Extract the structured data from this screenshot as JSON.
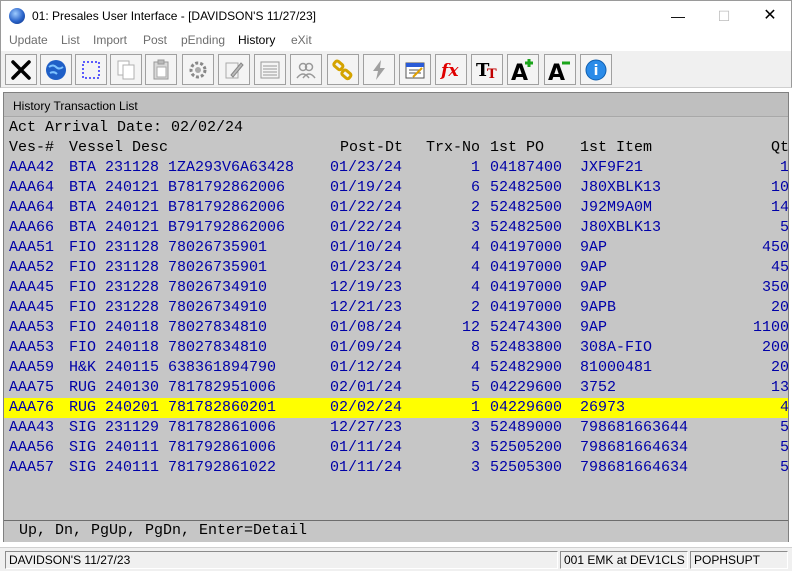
{
  "window": {
    "title": "01: Presales User Interface - [DAVIDSON'S 11/27/23]",
    "minimize": "—",
    "maximize": "☐",
    "close": "✕"
  },
  "menu": {
    "items": [
      {
        "label": "Update",
        "active": false
      },
      {
        "label": "List",
        "active": false
      },
      {
        "label": "Import",
        "active": false
      },
      {
        "label": "Post",
        "active": false
      },
      {
        "label": "pEnding",
        "active": false
      },
      {
        "label": "History",
        "active": true
      },
      {
        "label": "eXit",
        "active": false
      }
    ]
  },
  "toolbar": {
    "buttons": [
      "close-icon",
      "globe-icon",
      "select-icon",
      "copy-icon",
      "paste-icon",
      "settings-icon",
      "edit-icon",
      "list-icon",
      "users-icon",
      "link-icon",
      "lightning-icon",
      "calendar-icon",
      "function-icon",
      "font-size-icon",
      "font-increase-icon",
      "font-decrease-icon",
      "help-icon"
    ]
  },
  "panel": {
    "title": "History Transaction List",
    "arrival_label": "Act Arrival Date:",
    "arrival_value": "02/02/24",
    "columns": {
      "ves": "Ves-#",
      "desc": "Vessel Desc",
      "post": "Post-Dt",
      "trx": "Trx-No",
      "po": "1st PO",
      "item": "1st Item",
      "qty": "Qt"
    },
    "rows": [
      {
        "ves": "AAA42",
        "desc": "BTA 231128 1ZA293V6A63428",
        "post": "01/23/24",
        "trx": "1",
        "po": "04187400",
        "item": "JXF9F21",
        "qty": "1"
      },
      {
        "ves": "AAA64",
        "desc": "BTA 240121 B781792862006",
        "post": "01/19/24",
        "trx": "6",
        "po": "52482500",
        "item": "J80XBLK13",
        "qty": "10"
      },
      {
        "ves": "AAA64",
        "desc": "BTA 240121 B781792862006",
        "post": "01/22/24",
        "trx": "2",
        "po": "52482500",
        "item": "J92M9A0M",
        "qty": "14"
      },
      {
        "ves": "AAA66",
        "desc": "BTA 240121 B791792862006",
        "post": "01/22/24",
        "trx": "3",
        "po": "52482500",
        "item": "J80XBLK13",
        "qty": "5"
      },
      {
        "ves": "AAA51",
        "desc": "FIO 231128 78026735901",
        "post": "01/10/24",
        "trx": "4",
        "po": "04197000",
        "item": "9AP",
        "qty": "450"
      },
      {
        "ves": "AAA52",
        "desc": "FIO 231128 78026735901",
        "post": "01/23/24",
        "trx": "4",
        "po": "04197000",
        "item": "9AP",
        "qty": "45"
      },
      {
        "ves": "AAA45",
        "desc": "FIO 231228 78026734910",
        "post": "12/19/23",
        "trx": "4",
        "po": "04197000",
        "item": "9AP",
        "qty": "350"
      },
      {
        "ves": "AAA45",
        "desc": "FIO 231228 78026734910",
        "post": "12/21/23",
        "trx": "2",
        "po": "04197000",
        "item": "9APB",
        "qty": "20"
      },
      {
        "ves": "AAA53",
        "desc": "FIO 240118 78027834810",
        "post": "01/08/24",
        "trx": "12",
        "po": "52474300",
        "item": "9AP",
        "qty": "1100"
      },
      {
        "ves": "AAA53",
        "desc": "FIO 240118 78027834810",
        "post": "01/09/24",
        "trx": "8",
        "po": "52483800",
        "item": "308A-FIO",
        "qty": "200"
      },
      {
        "ves": "AAA59",
        "desc": "H&K 240115 638361894790",
        "post": "01/12/24",
        "trx": "4",
        "po": "52482900",
        "item": "81000481",
        "qty": "20"
      },
      {
        "ves": "AAA75",
        "desc": "RUG 240130 781782951006",
        "post": "02/01/24",
        "trx": "5",
        "po": "04229600",
        "item": "3752",
        "qty": "13"
      },
      {
        "ves": "AAA76",
        "desc": "RUG 240201 781782860201",
        "post": "02/02/24",
        "trx": "1",
        "po": "04229600",
        "item": "26973",
        "qty": "4",
        "selected": true
      },
      {
        "ves": "AAA43",
        "desc": "SIG 231129 781782861006",
        "post": "12/27/23",
        "trx": "3",
        "po": "52489000",
        "item": "798681663644",
        "qty": "5"
      },
      {
        "ves": "AAA56",
        "desc": "SIG 240111 781792861006",
        "post": "01/11/24",
        "trx": "3",
        "po": "52505200",
        "item": "798681664634",
        "qty": "5"
      },
      {
        "ves": "AAA57",
        "desc": "SIG 240111 781792861022",
        "post": "01/11/24",
        "trx": "3",
        "po": "52505300",
        "item": "798681664634",
        "qty": "5"
      }
    ],
    "footer": "Up, Dn, PgUp, PgDn, Enter=Detail"
  },
  "status": {
    "company": "DAVIDSON'S 11/27/23",
    "session": "001 EMK at DEV1CLS",
    "user": "POPHSUPT"
  },
  "colors": {
    "row_text": "#0000a8",
    "selected_bg": "#ffff00",
    "screen_bg": "#c6c6c6"
  }
}
